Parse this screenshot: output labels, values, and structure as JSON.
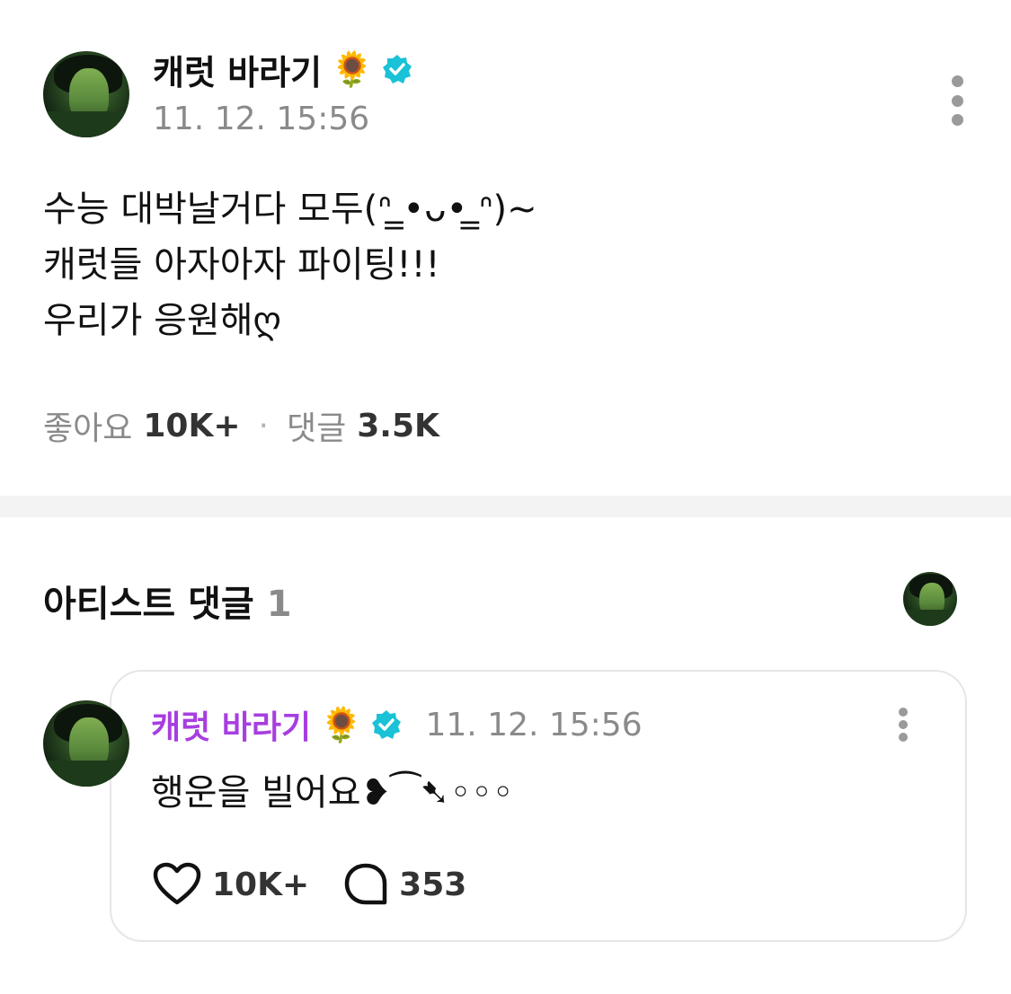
{
  "post": {
    "author": "캐럿 바라기",
    "author_emoji": "🌻",
    "timestamp": "11. 12. 15:56",
    "body_lines": [
      "수능 대박날거다 모두(ᐢ ̳•ᴗ• ̳ᐢ)~",
      "캐럿들 아자아자 파이팅!!!",
      "우리가 응원해ღ"
    ],
    "stats": {
      "likes_label": "좋아요",
      "likes_count": "10K+",
      "separator": "·",
      "comments_label": "댓글",
      "comments_count": "3.5K"
    }
  },
  "artist_comments": {
    "title": "아티스트 댓글",
    "count": "1"
  },
  "comment": {
    "author": "캐럿 바라기",
    "author_emoji": "🌻",
    "timestamp": "11. 12. 15:56",
    "text": "행운을 빌어요❥︎⁀➷◦◦◦",
    "likes_count": "10K+",
    "replies_count": "353"
  },
  "colors": {
    "verified": "#19c2d6",
    "comment_author": "#a73ee0",
    "muted": "#8a8a8a"
  }
}
